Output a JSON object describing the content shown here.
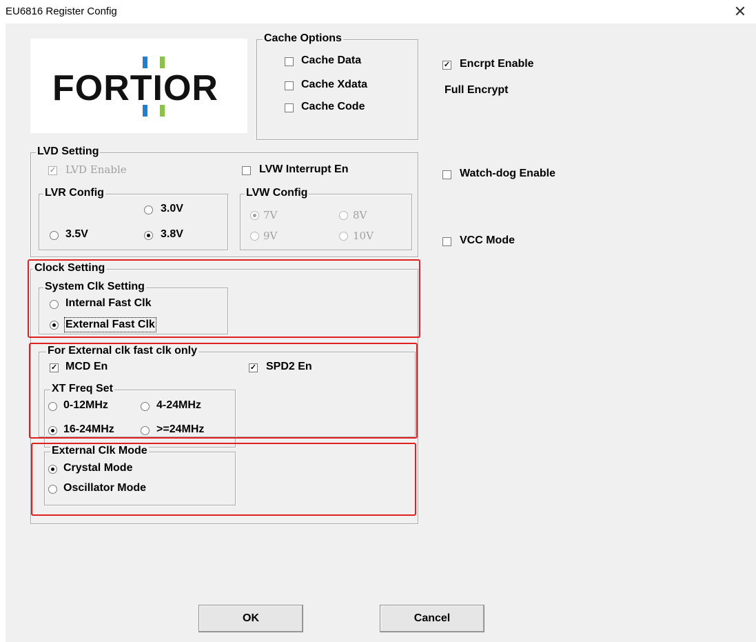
{
  "window": {
    "title": "EU6816 Register Config",
    "close_glyph": "✕"
  },
  "logo": {
    "text": "FORTIOR",
    "colors": {
      "blue": "#1f7fd1",
      "green": "#8bc34a"
    }
  },
  "cache_options": {
    "legend": "Cache Options",
    "items": [
      {
        "label": "Cache Data",
        "checked": false
      },
      {
        "label": "Cache Xdata",
        "checked": false
      },
      {
        "label": "Cache Code",
        "checked": false
      }
    ]
  },
  "encrypt": {
    "label": "Encrpt Enable",
    "checked": true,
    "mode_text": "Full Encrypt"
  },
  "watchdog": {
    "label": "Watch-dog Enable",
    "checked": false
  },
  "vcc_mode": {
    "label": "VCC Mode",
    "checked": false
  },
  "lvd": {
    "legend": "LVD Setting",
    "lvd_enable": {
      "label": "LVD Enable",
      "checked": true,
      "disabled": true
    },
    "lvw_interrupt": {
      "label": "LVW Interrupt En",
      "checked": false
    },
    "lvr": {
      "legend": "LVR Config",
      "options": [
        "3.0V",
        "3.5V",
        "3.8V"
      ],
      "selected": "3.8V"
    },
    "lvw": {
      "legend": "LVW Config",
      "options": [
        "7V",
        "8V",
        "9V",
        "10V"
      ],
      "selected": "7V",
      "disabled": true
    }
  },
  "clock": {
    "legend": "Clock Setting",
    "system": {
      "legend": "System Clk Setting",
      "options": [
        "Internal Fast Clk",
        "External Fast Clk"
      ],
      "selected": "External Fast Clk"
    }
  },
  "external": {
    "legend": "For External clk fast clk only",
    "mcd": {
      "label": "MCD En",
      "checked": true
    },
    "spd2": {
      "label": "SPD2 En",
      "checked": true
    },
    "xt": {
      "legend": "XT Freq Set",
      "options": [
        "0-12MHz",
        "4-24MHz",
        "16-24MHz",
        ">=24MHz"
      ],
      "selected": "16-24MHz"
    },
    "mode": {
      "legend": "External Clk Mode",
      "options": [
        "Crystal Mode",
        "Oscillator Mode"
      ],
      "selected": "Crystal Mode"
    }
  },
  "buttons": {
    "ok": "OK",
    "cancel": "Cancel"
  },
  "highlight_color": "#e02020",
  "check_glyph": "✓"
}
